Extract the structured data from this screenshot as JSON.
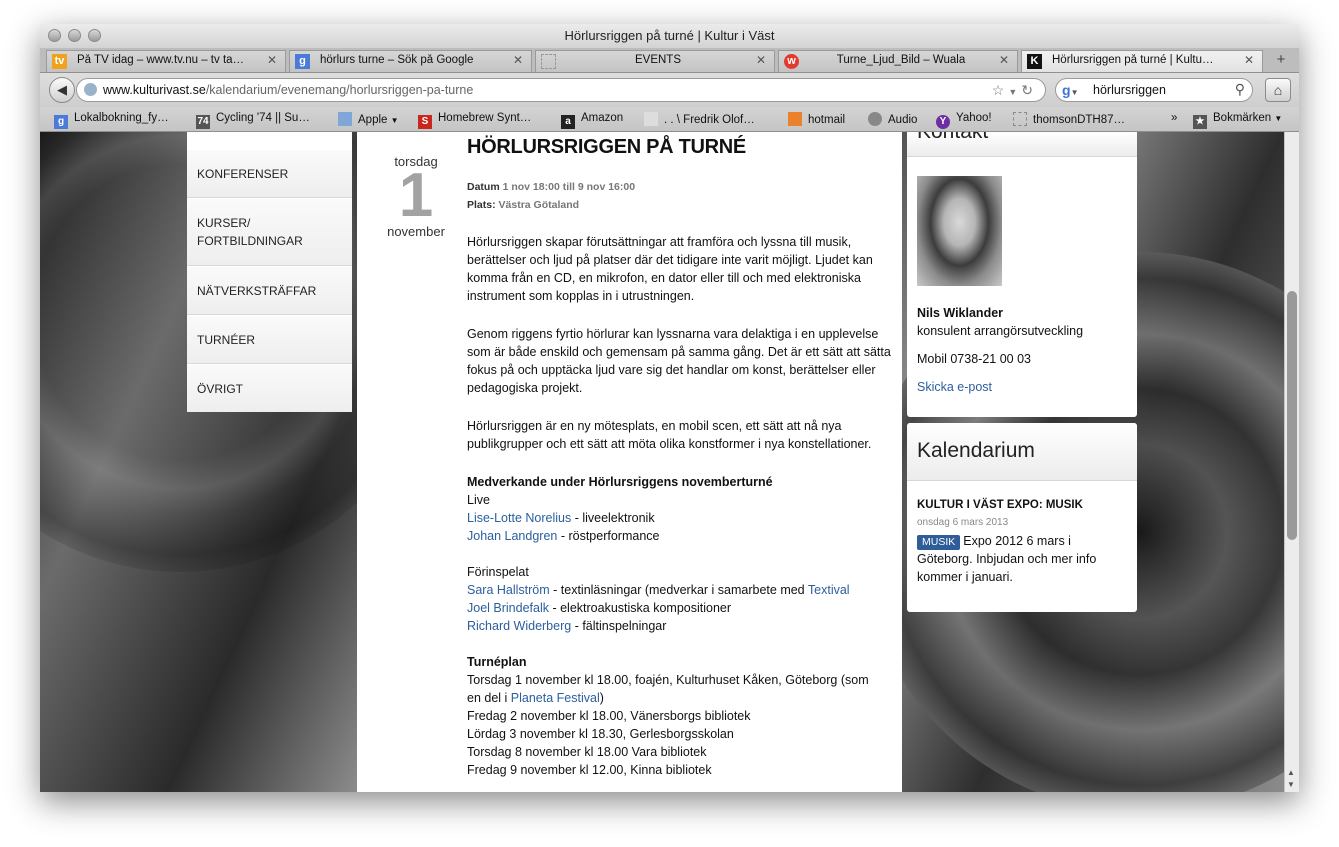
{
  "window": {
    "title": "Hörlursriggen på turné | Kultur i Väst"
  },
  "tabs": [
    {
      "label": "På TV idag – www.tv.nu – tv ta…",
      "icon": "tv-favicon-icon",
      "color": "#f0a21e"
    },
    {
      "label": "hörlurs turne – Sök på Google",
      "icon": "google-favicon-icon",
      "color": "#4a7bd9"
    },
    {
      "label": "EVENTS",
      "icon": "blank-page-icon",
      "color": "#cccccc"
    },
    {
      "label": "Turne_Ljud_Bild – Wuala",
      "icon": "wuala-favicon-icon",
      "color": "#e23a2e"
    },
    {
      "label": "Hörlursriggen på turné | Kultu…",
      "icon": "kulturivast-favicon-icon",
      "color": "#111111"
    }
  ],
  "url": {
    "domain": "www.kulturivast.se",
    "path": "/kalendarium/evenemang/horlursriggen-pa-turne"
  },
  "search": {
    "value": "hörlursriggen"
  },
  "bookmarks": [
    {
      "label": "Lokalbokning_fy…",
      "icon": "google-docs-icon",
      "color": "#4a7bd9"
    },
    {
      "label": "Cycling '74 || Su…",
      "icon": "cycling74-icon",
      "color": "#555555"
    },
    {
      "label": "Apple",
      "icon": "folder-icon",
      "color": "#7fa6d6"
    },
    {
      "label": "Homebrew Synt…",
      "icon": "homebrew-icon",
      "color": "#c8271e"
    },
    {
      "label": "Amazon",
      "icon": "amazon-icon",
      "color": "#222222"
    },
    {
      "label": ". . \\ Fredrik Olof…",
      "icon": "page-icon",
      "color": "#dddddd"
    },
    {
      "label": "hotmail",
      "icon": "msn-butterfly-icon",
      "color": "#e9822b"
    },
    {
      "label": "Audio",
      "icon": "apple-logo-icon",
      "color": "#888888"
    },
    {
      "label": "Yahoo!",
      "icon": "yahoo-icon",
      "color": "#6e2da3"
    },
    {
      "label": "thomsonDTH87…",
      "icon": "blank-page-icon",
      "color": "#cccccc"
    },
    {
      "label": "Bokmärken",
      "icon": "bookmarks-icon",
      "color": "#555555"
    }
  ],
  "leftnav": [
    "KONFERENSER",
    "KURSER/\nFORTBILDNINGAR",
    "NÄTVERKSTRÄFFAR",
    "TURNÉER",
    "ÖVRIGT"
  ],
  "event": {
    "weekday": "torsdag",
    "day": "1",
    "month": "november",
    "title": "HÖRLURSRIGGEN PÅ TURNÉ",
    "datum_label": "Datum",
    "datum_value": "1 nov 18:00 till 9 nov 16:00",
    "plats_label": "Plats:",
    "plats_value": "Västra Götaland",
    "p1": "Hörlursriggen skapar förutsättningar att framföra och lyssna till musik, berättelser och ljud på platser där det tidigare inte varit möjligt. Ljudet kan komma från en CD, en mikrofon, en dator eller till och med elektroniska instrument som kopplas in i utrustningen.",
    "p2": "Genom riggens fyrtio hörlurar kan lyssnarna vara delaktiga i en upplevelse som är både enskild och gemensam på samma gång. Det är ett sätt att sätta fokus på och upptäcka ljud vare sig det handlar om konst, berättelser eller pedagogiska projekt.",
    "p3": "Hörlursriggen är en ny mötesplats, en mobil scen, ett sätt att nå nya publikgrupper och ett sätt att möta olika konstformer i nya konstellationer.",
    "medverkande_heading": "Medverkande under Hörlursriggens novemberturné",
    "live_label": "Live",
    "live": [
      {
        "name": "Lise-Lotte Norelius",
        "role": " - liveelektronik"
      },
      {
        "name": "Johan Landgren",
        "role": " - röstperformance"
      }
    ],
    "forinspelat_label": "Förinspelat",
    "forinspelat": [
      {
        "name": "Sara Hallström",
        "role": " - textinläsningar (medverkar i samarbete med ",
        "extra_link": "Textival"
      },
      {
        "name": "Joel Brindefalk",
        "role": " - elektroakustiska kompositioner"
      },
      {
        "name": "Richard Widerberg",
        "role": " - fältinspelningar"
      }
    ],
    "turneplan_heading": "Turnéplan",
    "turneplan_1a": "Torsdag 1 november kl 18.00, foajén, Kulturhuset Kåken, Göteborg (som",
    "turneplan_1b": "en del i ",
    "turneplan_1_link": "Planeta Festival",
    "turneplan_1c": ")",
    "turneplan": [
      "Fredag 2 november kl 18.00, Vänersborgs bibliotek",
      "Lördag 3 november kl 18.30, Gerlesborgsskolan",
      "Torsdag 8 november kl 18.00 Vara bibliotek",
      "Fredag 9 november kl 12.00, Kinna bibliotek"
    ]
  },
  "contact": {
    "heading_partial": "Kontakt",
    "name": "Nils Wiklander",
    "role": "konsulent arrangörsutveckling",
    "phone": "Mobil 0738-21 00 03",
    "email_link": "Skicka e-post"
  },
  "calendar": {
    "title": "Kalendarium",
    "item_title": "KULTUR I VÄST EXPO: MUSIK",
    "item_date": "onsdag 6 mars 2013",
    "item_badge": "MUSIK",
    "item_text": "Expo 2012 6 mars i Göteborg. Inbjudan och mer info kommer i januari."
  }
}
